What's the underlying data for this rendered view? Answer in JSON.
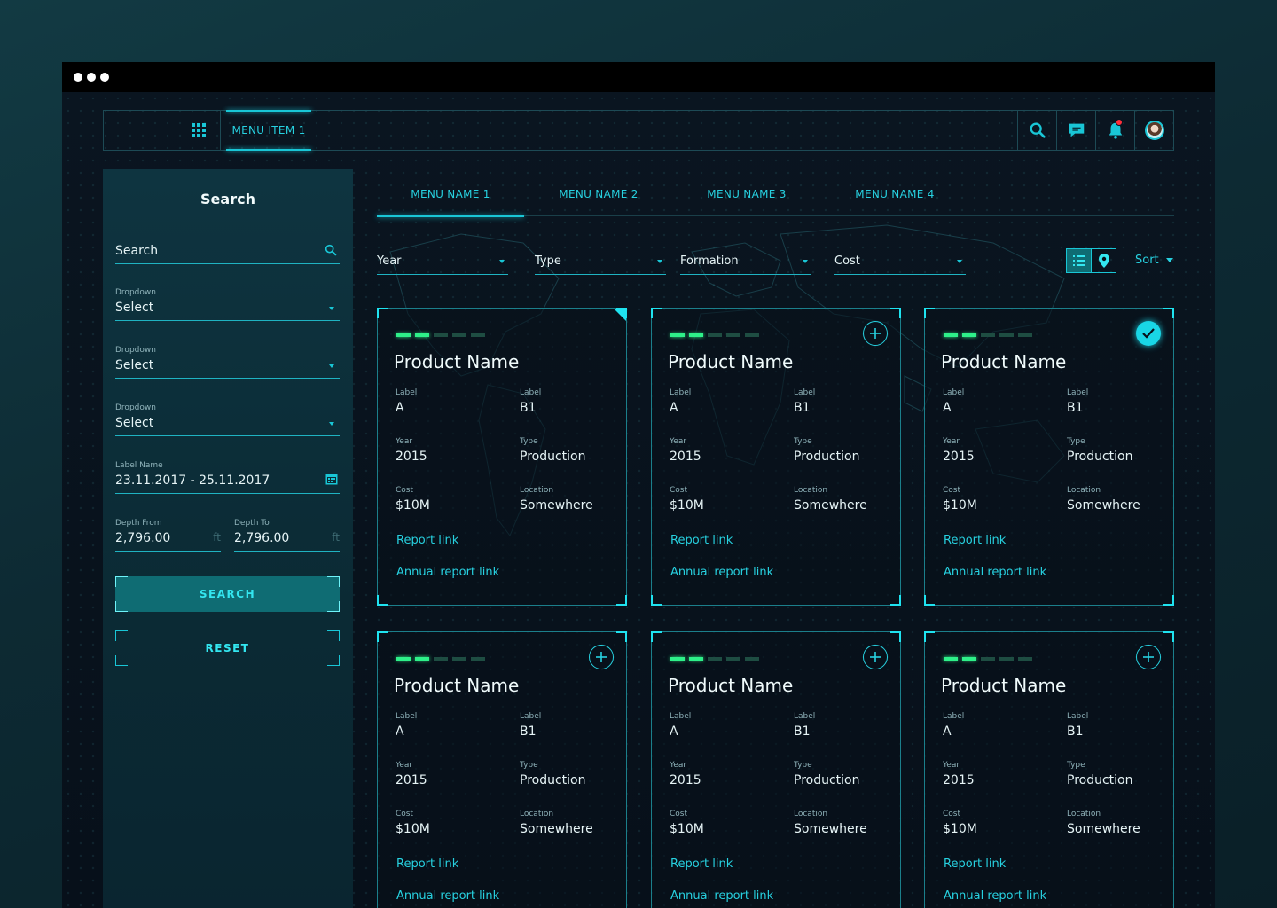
{
  "topbar": {
    "menu_item": "MENU ITEM 1",
    "icons": [
      "grid-icon",
      "search-icon",
      "chat-icon",
      "bell-icon",
      "avatar"
    ],
    "accent": "#19c6d6",
    "notification_color": "#ff2f3a"
  },
  "sidebar": {
    "title": "Search",
    "search_placeholder": "Search",
    "dropdowns": [
      {
        "label": "Dropdown",
        "value": "Select"
      },
      {
        "label": "Dropdown",
        "value": "Select"
      },
      {
        "label": "Dropdown",
        "value": "Select"
      }
    ],
    "date_range": {
      "label": "Label Name",
      "value": "23.11.2017 - 25.11.2017"
    },
    "depth_from": {
      "label": "Depth From",
      "value": "2,796.00",
      "unit": "ft"
    },
    "depth_to": {
      "label": "Depth To",
      "value": "2,796.00",
      "unit": "ft"
    },
    "search_button": "SEARCH",
    "reset_button": "RESET"
  },
  "tabs": [
    {
      "label": "MENU NAME 1",
      "active": true
    },
    {
      "label": "MENU NAME 2",
      "active": false
    },
    {
      "label": "MENU NAME 3",
      "active": false
    },
    {
      "label": "MENU NAME 4",
      "active": false
    }
  ],
  "filters": [
    {
      "label": "Year"
    },
    {
      "label": "Type"
    },
    {
      "label": "Formation"
    },
    {
      "label": "Cost"
    }
  ],
  "sort_label": "Sort",
  "cards": [
    {
      "state": "flagged",
      "rating_level": 2,
      "title": "Product Name",
      "label1_k": "Label",
      "label1_v": "A",
      "label2_k": "Label",
      "label2_v": "B1",
      "year_k": "Year",
      "year_v": "2015",
      "type_k": "Type",
      "type_v": "Production",
      "cost_k": "Cost",
      "cost_v": "$10M",
      "location_k": "Location",
      "location_v": "Somewhere",
      "report_link": "Report link",
      "annual_link": "Annual report link"
    },
    {
      "state": "add",
      "rating_level": 2,
      "title": "Product Name",
      "label1_k": "Label",
      "label1_v": "A",
      "label2_k": "Label",
      "label2_v": "B1",
      "year_k": "Year",
      "year_v": "2015",
      "type_k": "Type",
      "type_v": "Production",
      "cost_k": "Cost",
      "cost_v": "$10M",
      "location_k": "Location",
      "location_v": "Somewhere",
      "report_link": "Report link",
      "annual_link": "Annual report link"
    },
    {
      "state": "selected",
      "rating_level": 2,
      "title": "Product Name",
      "label1_k": "Label",
      "label1_v": "A",
      "label2_k": "Label",
      "label2_v": "B1",
      "year_k": "Year",
      "year_v": "2015",
      "type_k": "Type",
      "type_v": "Production",
      "cost_k": "Cost",
      "cost_v": "$10M",
      "location_k": "Location",
      "location_v": "Somewhere",
      "report_link": "Report link",
      "annual_link": "Annual report link"
    },
    {
      "state": "add",
      "rating_level": 2,
      "title": "Product Name",
      "label1_k": "Label",
      "label1_v": "A",
      "label2_k": "Label",
      "label2_v": "B1",
      "year_k": "Year",
      "year_v": "2015",
      "type_k": "Type",
      "type_v": "Production",
      "cost_k": "Cost",
      "cost_v": "$10M",
      "location_k": "Location",
      "location_v": "Somewhere",
      "report_link": "Report link",
      "annual_link": "Annual report link"
    },
    {
      "state": "add",
      "rating_level": 2,
      "title": "Product Name",
      "label1_k": "Label",
      "label1_v": "A",
      "label2_k": "Label",
      "label2_v": "B1",
      "year_k": "Year",
      "year_v": "2015",
      "type_k": "Type",
      "type_v": "Production",
      "cost_k": "Cost",
      "cost_v": "$10M",
      "location_k": "Location",
      "location_v": "Somewhere",
      "report_link": "Report link",
      "annual_link": "Annual report link"
    },
    {
      "state": "add",
      "rating_level": 2,
      "title": "Product Name",
      "label1_k": "Label",
      "label1_v": "A",
      "label2_k": "Label",
      "label2_v": "B1",
      "year_k": "Year",
      "year_v": "2015",
      "type_k": "Type",
      "type_v": "Production",
      "cost_k": "Cost",
      "cost_v": "$10M",
      "location_k": "Location",
      "location_v": "Somewhere",
      "report_link": "Report link",
      "annual_link": "Annual report link"
    }
  ]
}
